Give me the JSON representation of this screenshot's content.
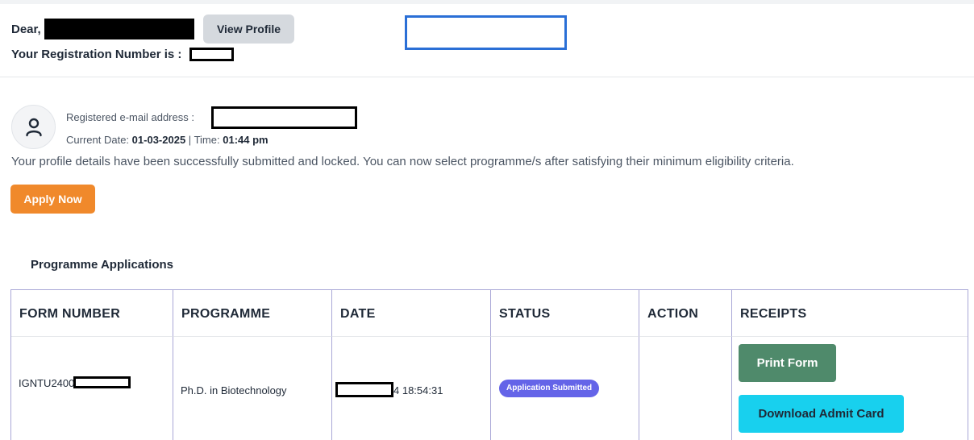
{
  "header": {
    "greeting": "Dear,",
    "view_profile_label": "View Profile",
    "registration_label": "Your Registration Number is :"
  },
  "profile": {
    "email_label": "Registered e-mail address :",
    "current_date_label": "Current Date:",
    "current_date": "01-03-2025",
    "separator": "|",
    "time_label": "Time:",
    "time": "01:44 pm",
    "message": "Your profile details have been successfully submitted and locked. You can now select programme/s after satisfying their minimum eligibility criteria.",
    "apply_now_label": "Apply Now"
  },
  "applications": {
    "title": "Programme Applications",
    "columns": [
      "FORM NUMBER",
      "PROGRAMME",
      "DATE",
      "STATUS",
      "ACTION",
      "RECEIPTS"
    ],
    "rows": [
      {
        "form_number_visible": "IGNTU2400",
        "programme": "Ph.D. in Biotechnology",
        "date_visible": "4 18:54:31",
        "status": "Application Submitted",
        "action": "",
        "print_form_label": "Print Form",
        "admit_card_label": "Download Admit Card"
      }
    ]
  },
  "colors": {
    "apply_now": "#f0892b",
    "view_profile": "#d5d9de",
    "status_badge": "#6464e8",
    "print_form": "#4f8a6b",
    "admit_card": "#18d0ee",
    "table_border": "#a9a7d6",
    "focus_box": "#2a6fd6"
  },
  "icons": {
    "avatar": "user-icon"
  }
}
